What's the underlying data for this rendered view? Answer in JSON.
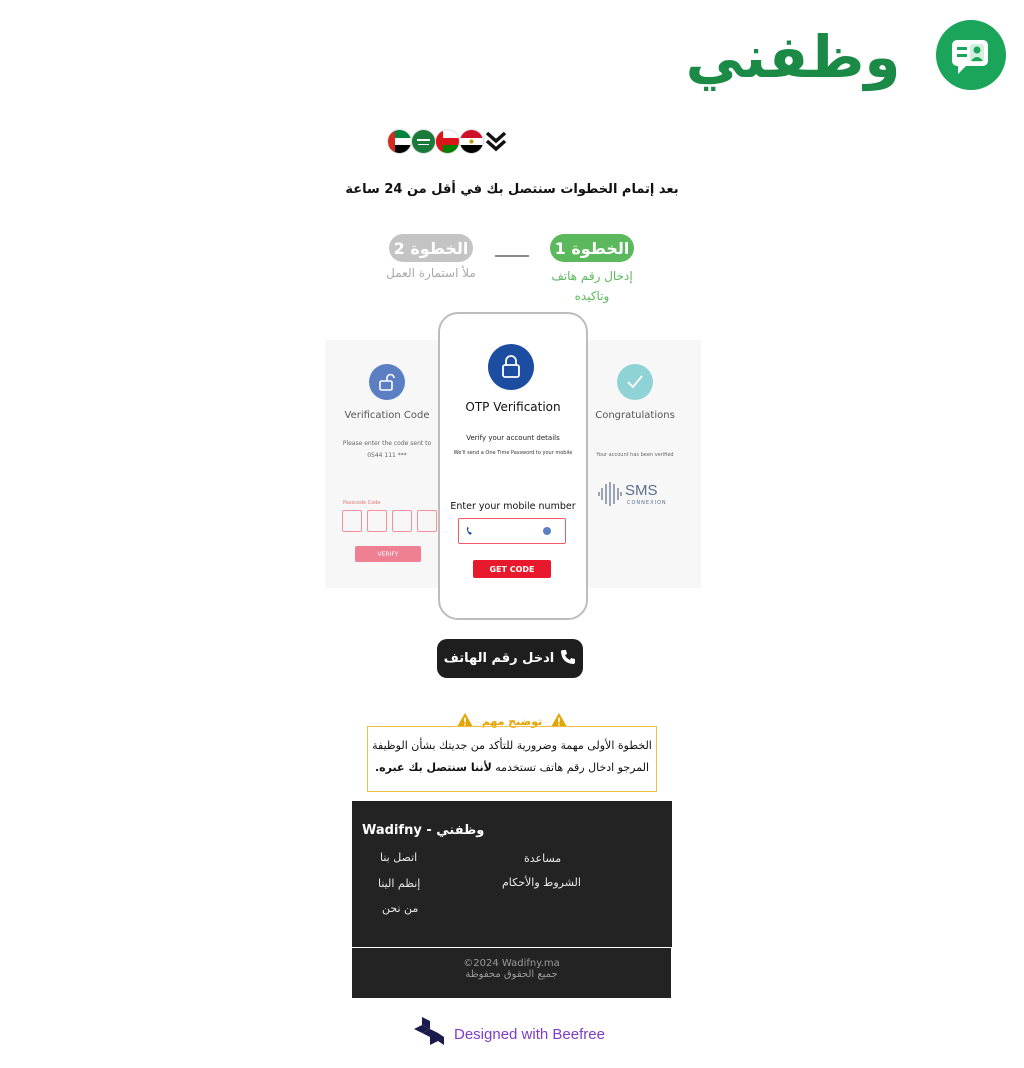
{
  "logo": {
    "text": "وظفني",
    "colors": {
      "primary": "#1b8a46",
      "icon_bg": "#1aa55a"
    },
    "icon": "chat-profile-icon"
  },
  "flags": [
    {
      "name": "uae-flag"
    },
    {
      "name": "saudi-flag"
    },
    {
      "name": "oman-flag"
    },
    {
      "name": "egypt-flag"
    }
  ],
  "headline": "بعد إتمام  الخطوات سنتصل بك في أقل من 24 ساعة",
  "steps": [
    {
      "label": "الخطوة 1",
      "desc_line1": "إدخال رقم هاتف",
      "desc_line2": "وتاكيده",
      "color": "#5cb85c"
    },
    {
      "label": "الخطوة 2",
      "desc": "ملأ استمارة العمل",
      "color": "#c4c4c4"
    }
  ],
  "illustration": {
    "left_panel": {
      "title": "Verification Code",
      "text_line1": "Please enter the code sent to",
      "text_line2": "0544 111 ***",
      "field_label": "Passcode Code",
      "button": "VERIFY"
    },
    "phone": {
      "title": "OTP Verification",
      "subtitle": "Verify your account details",
      "note": "We'll send a One Time Password to your mobile",
      "prompt": "Enter your mobile number",
      "button": "GET CODE"
    },
    "right_panel": {
      "title": "Congratulations",
      "text": "Your account has been verified",
      "brand_main": "SMS",
      "brand_sub": "CONNEXION"
    }
  },
  "cta": {
    "label": "ادخل رقم الهاتف",
    "icon": "phone-icon"
  },
  "notice": {
    "title": "توضيح مهم",
    "line1": "الخطوة الأولى مهمة وضرورية للتأكد من جديتك بشأن الوظيفة",
    "line2_normal": "المرجو ادخال رقم هاتف تستخدمه ",
    "line2_bold": "لأننا سنتصل بك عبره."
  },
  "footer": {
    "brand": "وظفني - Wadifny",
    "links_right": [
      "اتصل بنا",
      "إنظم الينا",
      "من نحن"
    ],
    "links_left": [
      "مساعدة",
      "الشروط والأحكام"
    ],
    "copyright": "©2024 Wadifny.ma",
    "rights": "جميع الحقوق محفوظة"
  },
  "beefree": {
    "label": "Designed with Beefree",
    "color": "#7d3cc9"
  }
}
